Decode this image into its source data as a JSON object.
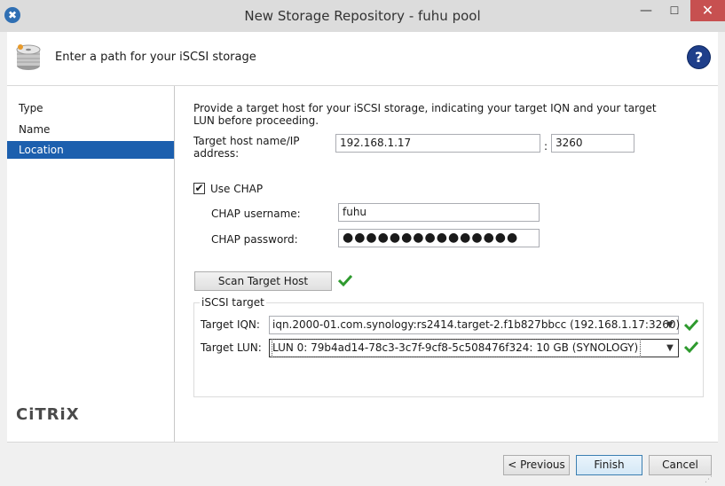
{
  "window": {
    "title": "New Storage Repository - fuhu pool",
    "min_glyph": "—",
    "max_glyph": "☐",
    "close_glyph": "✕",
    "app_icon": "xenserver-icon"
  },
  "header": {
    "title": "Enter a path for your iSCSI storage",
    "help_glyph": "?"
  },
  "sidebar": {
    "items": [
      {
        "label": "Type",
        "active": false
      },
      {
        "label": "Name",
        "active": false
      },
      {
        "label": "Location",
        "active": true
      }
    ],
    "logo_text": "CiTRiX"
  },
  "form": {
    "intro_line1": "Provide a target host for your iSCSI storage, indicating your target IQN and your target",
    "intro_line2": "LUN before proceeding.",
    "host_label_line1": "Target host name/IP",
    "host_label_line2": "address:",
    "host_value": "192.168.1.17",
    "port_separator": ":",
    "port_value": "3260",
    "use_chap_label": "Use CHAP",
    "use_chap_checked": "✔",
    "chap_username_label": "CHAP username:",
    "chap_username_value": "fuhu",
    "chap_password_label": "CHAP password:",
    "chap_password_value": "●●●●●●●●●●●●●●●",
    "scan_button": "Scan Target Host",
    "group_label": "iSCSI target",
    "iqn_label": "Target IQN:",
    "iqn_value": "iqn.2000-01.com.synology:rs2414.target-2.f1b827bbcc (192.168.1.17:3260)",
    "lun_label": "Target LUN:",
    "lun_value": "LUN 0: 79b4ad14-78c3-3c7f-9cf8-5c508476f324: 10 GB (SYNOLOGY)",
    "dropdown_glyph": "▼"
  },
  "footer": {
    "previous_button": "< Previous",
    "finish_button": "Finish",
    "cancel_button": "Cancel"
  },
  "colors": {
    "accent": "#1c5fae",
    "check_green": "#2e9a2e"
  }
}
